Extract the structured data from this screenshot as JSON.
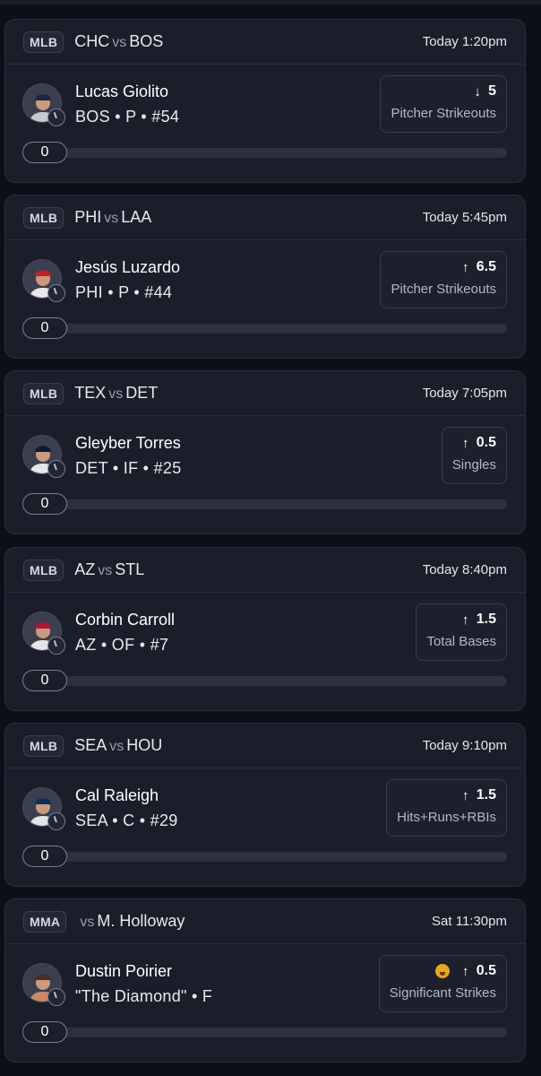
{
  "cards": [
    {
      "league": "MLB",
      "team_a": "CHC",
      "vs": "vs",
      "team_b": "BOS",
      "time": "Today 1:20pm",
      "player": "Lucas Giolito",
      "info": "BOS • P • #54",
      "direction": "down",
      "arrow": "↓",
      "line": "5",
      "category": "Pitcher Strikeouts",
      "progress": "0",
      "jersey_color": "#c8c9cf",
      "cap_color": "#1d2440"
    },
    {
      "league": "MLB",
      "team_a": "PHI",
      "vs": "vs",
      "team_b": "LAA",
      "time": "Today 5:45pm",
      "player": "Jesús Luzardo",
      "info": "PHI • P • #44",
      "direction": "up",
      "arrow": "↑",
      "line": "6.5",
      "category": "Pitcher Strikeouts",
      "progress": "0",
      "jersey_color": "#e8e8ec",
      "cap_color": "#c21e2e"
    },
    {
      "league": "MLB",
      "team_a": "TEX",
      "vs": "vs",
      "team_b": "DET",
      "time": "Today 7:05pm",
      "player": "Gleyber Torres",
      "info": "DET • IF • #25",
      "direction": "up",
      "arrow": "↑",
      "line": "0.5",
      "category": "Singles",
      "progress": "0",
      "jersey_color": "#e5e6ea",
      "cap_color": "#0f1b33"
    },
    {
      "league": "MLB",
      "team_a": "AZ",
      "vs": "vs",
      "team_b": "STL",
      "time": "Today 8:40pm",
      "player": "Corbin Carroll",
      "info": "AZ • OF • #7",
      "direction": "up",
      "arrow": "↑",
      "line": "1.5",
      "category": "Total Bases",
      "progress": "0",
      "jersey_color": "#e6e6ea",
      "cap_color": "#a71930"
    },
    {
      "league": "MLB",
      "team_a": "SEA",
      "vs": "vs",
      "team_b": "HOU",
      "time": "Today 9:10pm",
      "player": "Cal Raleigh",
      "info": "SEA • C • #29",
      "direction": "up",
      "arrow": "↑",
      "line": "1.5",
      "category": "Hits+Runs+RBIs",
      "progress": "0",
      "jersey_color": "#e3e4e8",
      "cap_color": "#0c2c56"
    },
    {
      "league": "MMA",
      "team_a": "",
      "vs": "vs",
      "team_b": "M. Holloway",
      "time": "Sat 11:30pm",
      "player": "Dustin Poirier",
      "info": "\"The Diamond\" • F",
      "direction": "up",
      "arrow": "↑",
      "line": "0.5",
      "category": "Significant Strikes",
      "progress": "0",
      "emoji": "grinning-face-emoji",
      "jersey_color": "#c98a6a",
      "cap_color": "#4a2e22"
    }
  ]
}
